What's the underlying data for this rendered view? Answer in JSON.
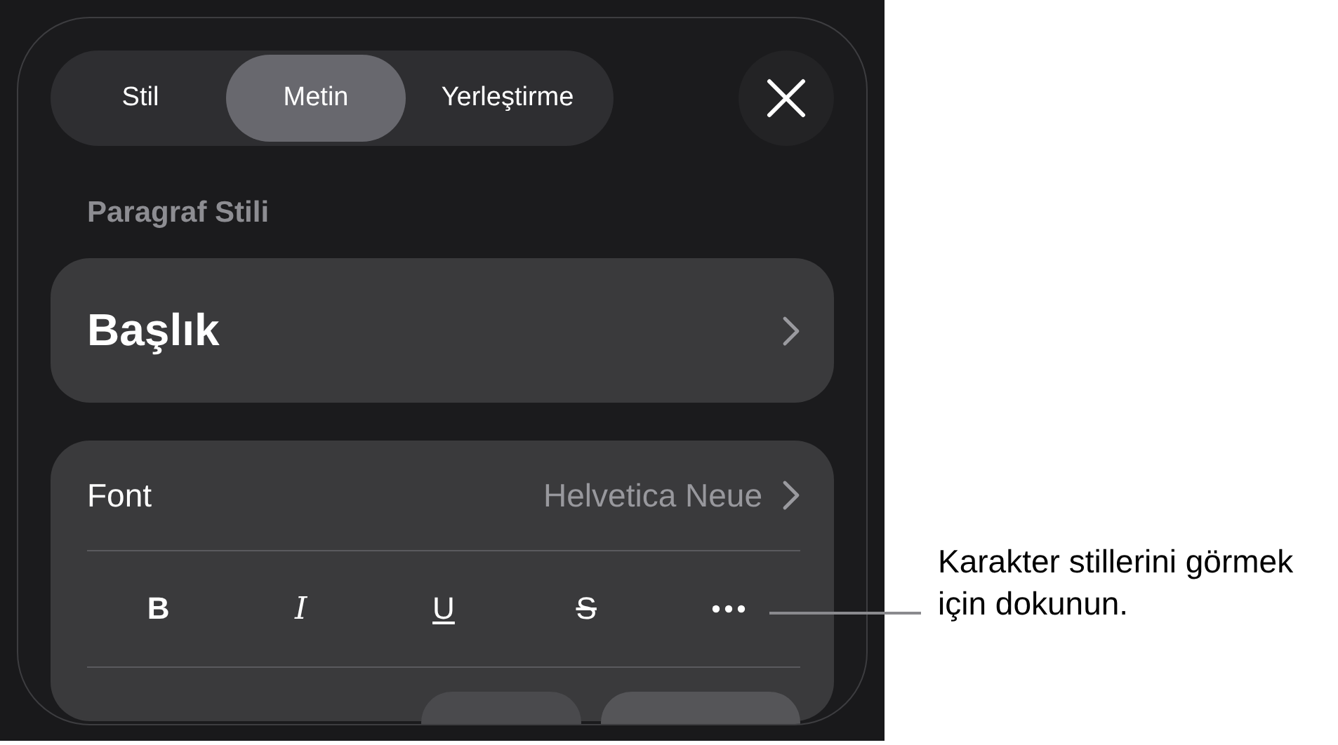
{
  "tabs": [
    {
      "label": "Stil",
      "selected": false
    },
    {
      "label": "Metin",
      "selected": true
    },
    {
      "label": "Yerleştirme",
      "selected": false
    }
  ],
  "section_title": "Paragraf Stili",
  "paragraph_style": {
    "value": "Başlık"
  },
  "font_row": {
    "label": "Font",
    "value": "Helvetica Neue"
  },
  "style_buttons": [
    {
      "label": "B",
      "kind": "bold"
    },
    {
      "label": "I",
      "kind": "italic"
    },
    {
      "label": "U",
      "kind": "underline"
    },
    {
      "label": "S",
      "kind": "strike"
    },
    {
      "kind": "more"
    }
  ],
  "callout": "Karakter stillerini görmek için dokunun."
}
